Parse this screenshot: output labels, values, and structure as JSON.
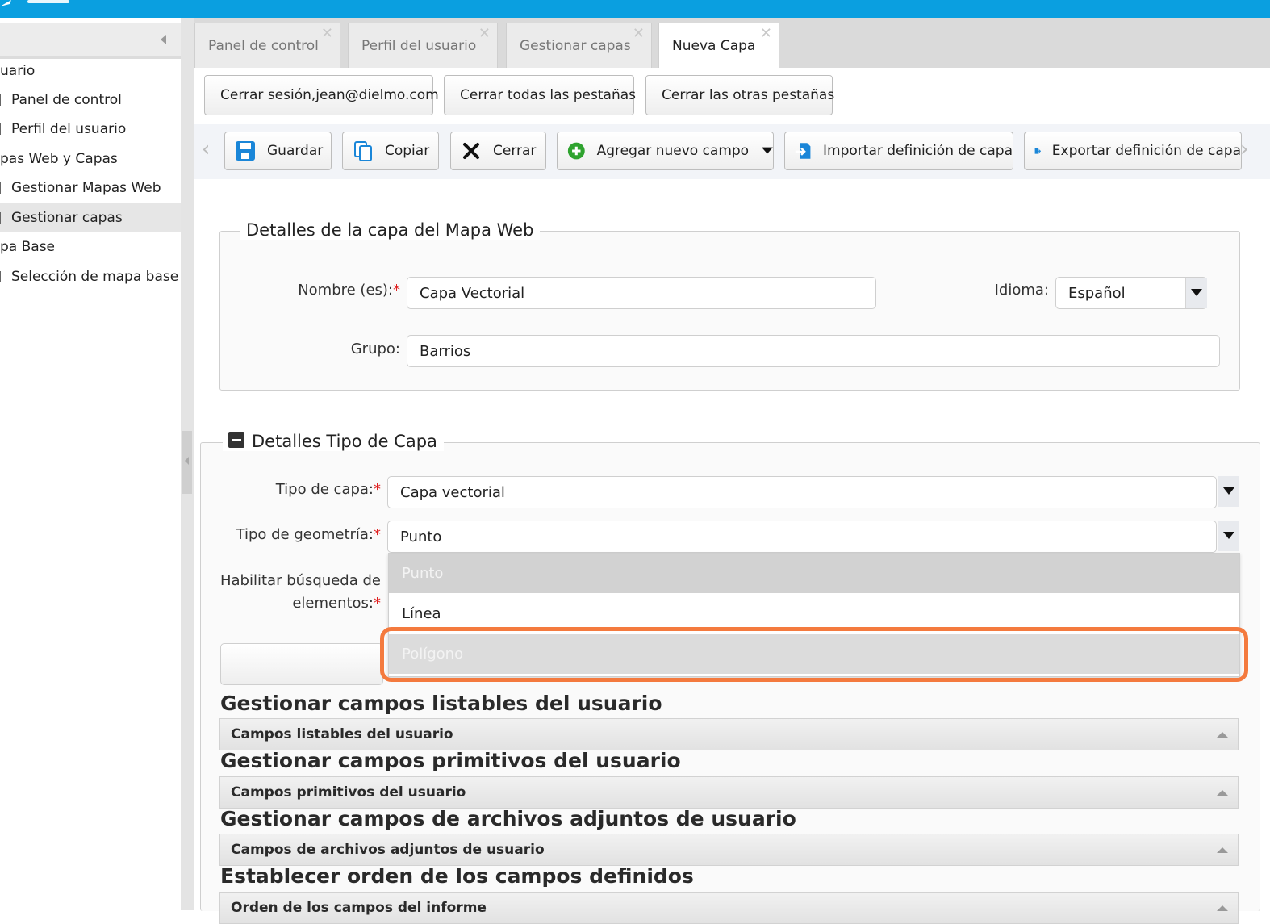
{
  "sidebar": {
    "items": [
      {
        "label": "uario",
        "kind": "group"
      },
      {
        "label": "Panel de control",
        "kind": "sub"
      },
      {
        "label": "Perfil del usuario",
        "kind": "sub"
      },
      {
        "label": "pas Web y Capas",
        "kind": "group"
      },
      {
        "label": "Gestionar Mapas Web",
        "kind": "sub"
      },
      {
        "label": "Gestionar capas",
        "kind": "sub",
        "active": true
      },
      {
        "label": "pa Base",
        "kind": "group"
      },
      {
        "label": "Selección de mapa base",
        "kind": "sub"
      }
    ]
  },
  "tabs": [
    {
      "label": "Panel de control"
    },
    {
      "label": "Perfil del usuario"
    },
    {
      "label": "Gestionar capas"
    },
    {
      "label": "Nueva Capa",
      "active": true
    }
  ],
  "session": {
    "logout_label": "Cerrar sesión,jean@dielmo.com",
    "close_all_label": "Cerrar todas las pestañas",
    "close_others_label": "Cerrar las otras pestañas"
  },
  "toolbar": {
    "save_label": "Guardar",
    "copy_label": "Copiar",
    "close_label": "Cerrar",
    "add_field_label": "Agregar nuevo campo",
    "import_label": "Importar definición de capa",
    "export_label": "Exportar definición de capa"
  },
  "layer_details": {
    "legend": "Detalles de la capa del Mapa Web",
    "name_label": "Nombre (es):",
    "name_value": "Capa Vectorial",
    "language_label": "Idioma:",
    "language_value": "Español",
    "group_label": "Grupo:",
    "group_value": "Barrios"
  },
  "layer_type": {
    "legend": "Detalles Tipo de Capa",
    "type_label": "Tipo de capa:",
    "type_value": "Capa vectorial",
    "geometry_label": "Tipo de geometría:",
    "geometry_value": "Punto",
    "search_label_1": "Habilitar búsqueda de",
    "search_label_2": "elementos:",
    "required_mark": "*",
    "geometry_options": [
      "Punto",
      "Línea",
      "Polígono"
    ]
  },
  "sections": [
    {
      "title": "Gestionar campos listables del usuario",
      "panel": "Campos listables del usuario"
    },
    {
      "title": "Gestionar campos primitivos del usuario",
      "panel": "Campos primitivos del usuario"
    },
    {
      "title": "Gestionar campos de archivos adjuntos de usuario",
      "panel": "Campos de archivos adjuntos de usuario"
    },
    {
      "title": "Establecer orden de los campos definidos",
      "panel": "Orden de los campos del informe"
    }
  ],
  "colors": {
    "topbar": "#0a9fe0",
    "highlight": "#f47a3e",
    "required": "#e02020",
    "save_icon": "#1a86d8",
    "add_icon": "#2fa32f"
  },
  "icons": {
    "save": "floppy-disk-icon",
    "copy": "copy-icon",
    "close": "close-x-icon",
    "add": "plus-circle-icon",
    "import": "import-icon",
    "export": "export-icon"
  }
}
